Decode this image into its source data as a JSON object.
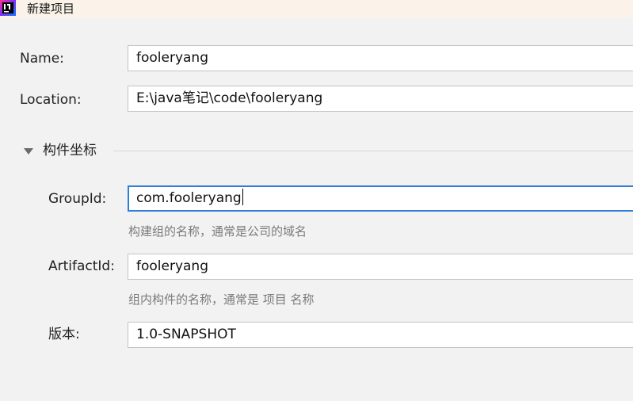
{
  "window": {
    "title": "新建项目"
  },
  "form": {
    "name_label": "Name:",
    "name_value": "fooleryang",
    "location_label": "Location:",
    "location_value": "E:\\java笔记\\code\\fooleryang"
  },
  "artifact_section": {
    "title": "构件坐标",
    "expanded": true,
    "group_id_label": "GroupId:",
    "group_id_value": "com.fooleryang",
    "group_id_hint": "构建组的名称，通常是公司的域名",
    "artifact_id_label": "ArtifactId:",
    "artifact_id_value": "fooleryang",
    "artifact_id_hint": "组内构件的名称，通常是 项目 名称",
    "version_label": "版本:",
    "version_value": "1.0-SNAPSHOT"
  },
  "colors": {
    "background": "#f2f2f2",
    "focus_border": "#2f7fd8",
    "hint_text": "#7a7a7a"
  },
  "icons": {
    "app": "intellij-app-icon",
    "expand": "triangle-down-icon"
  }
}
